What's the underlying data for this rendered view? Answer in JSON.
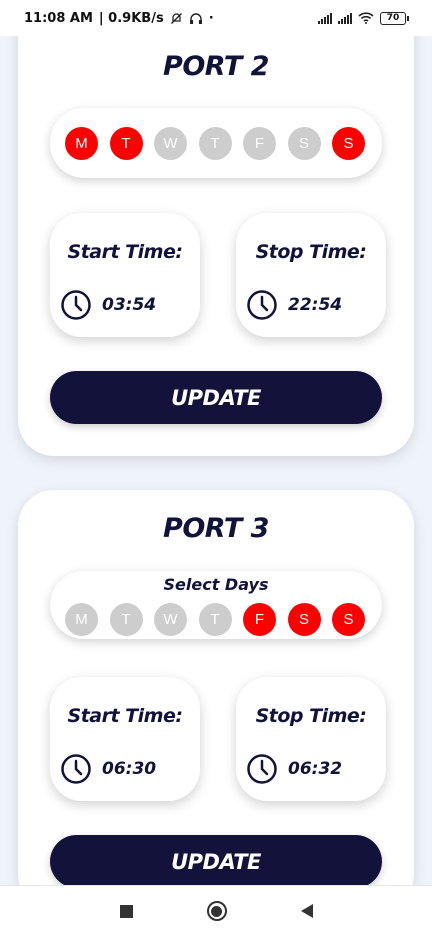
{
  "status": {
    "time": "11:08 AM",
    "speed": "| 0.9KB/s",
    "battery": "70",
    "icons": [
      "mute-bell-icon",
      "headphones-icon",
      "signal-icon",
      "signal-icon",
      "wifi-icon",
      "battery-icon"
    ]
  },
  "ports": [
    {
      "title": "PORT 2",
      "select_label": "",
      "days": [
        {
          "label": "M",
          "on": true
        },
        {
          "label": "T",
          "on": true
        },
        {
          "label": "W",
          "on": false
        },
        {
          "label": "T",
          "on": false
        },
        {
          "label": "F",
          "on": false
        },
        {
          "label": "S",
          "on": false
        },
        {
          "label": "S",
          "on": true
        }
      ],
      "start_label": "Start Time:",
      "start_time": "03:54",
      "stop_label": "Stop Time:",
      "stop_time": "22:54",
      "update_label": "UPDATE"
    },
    {
      "title": "PORT 3",
      "select_label": "Select Days",
      "days": [
        {
          "label": "M",
          "on": false
        },
        {
          "label": "T",
          "on": false
        },
        {
          "label": "W",
          "on": false
        },
        {
          "label": "T",
          "on": false
        },
        {
          "label": "F",
          "on": true
        },
        {
          "label": "S",
          "on": true
        },
        {
          "label": "S",
          "on": true
        }
      ],
      "start_label": "Start Time:",
      "start_time": "06:30",
      "stop_label": "Stop Time:",
      "stop_time": "06:32",
      "update_label": "UPDATE"
    }
  ],
  "colors": {
    "accent": "#ff0000",
    "inactive": "#cdcdcd",
    "navy": "#12123a"
  },
  "nav": [
    "recents-square-icon",
    "home-circle-icon",
    "back-triangle-icon"
  ]
}
